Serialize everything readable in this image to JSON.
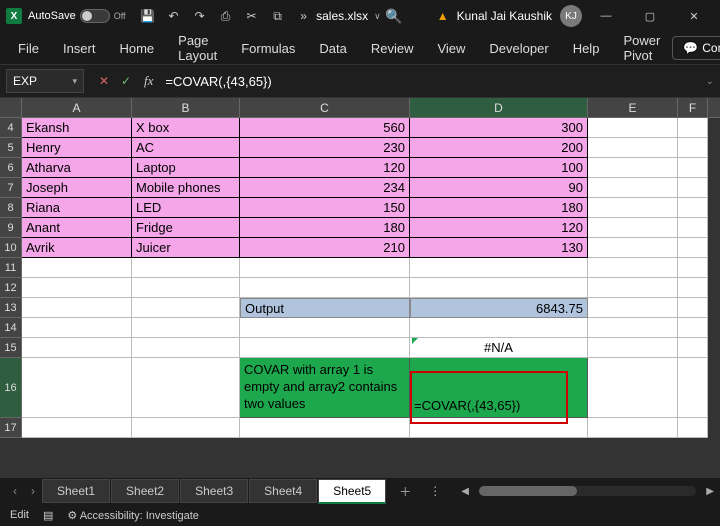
{
  "titlebar": {
    "autosave_label": "AutoSave",
    "autosave_state": "Off",
    "filename": "sales.xlsx",
    "filename_chev": "∨",
    "user_name": "Kunal Jai Kaushik",
    "user_initials": "KJ"
  },
  "ribbon": {
    "tabs": [
      "File",
      "Insert",
      "Home",
      "Page Layout",
      "Formulas",
      "Data",
      "Review",
      "View",
      "Developer",
      "Help",
      "Power Pivot"
    ],
    "comments": "Comments"
  },
  "formula_bar": {
    "namebox": "EXP",
    "formula": "=COVAR(,{43,65})"
  },
  "columns": [
    "A",
    "B",
    "C",
    "D",
    "E",
    "F"
  ],
  "rows": [
    {
      "n": "4",
      "A": "Ekansh",
      "B": "X box",
      "C": "560",
      "D": "300"
    },
    {
      "n": "5",
      "A": "Henry",
      "B": "AC",
      "C": "230",
      "D": "200"
    },
    {
      "n": "6",
      "A": "Atharva",
      "B": "Laptop",
      "C": "120",
      "D": "100"
    },
    {
      "n": "7",
      "A": "Joseph",
      "B": "Mobile phones",
      "C": "234",
      "D": "90"
    },
    {
      "n": "8",
      "A": "Riana",
      "B": "LED",
      "C": "150",
      "D": "180"
    },
    {
      "n": "9",
      "A": "Anant",
      "B": "Fridge",
      "C": "180",
      "D": "120"
    },
    {
      "n": "10",
      "A": "Avrik",
      "B": "Juicer",
      "C": "210",
      "D": "130"
    }
  ],
  "output_row": {
    "n": "13",
    "label": "Output",
    "value": "6843.75"
  },
  "na_row": {
    "n": "15",
    "value": "#N/A"
  },
  "covar_row": {
    "n": "16",
    "desc": "COVAR with array 1 is empty and array2 contains two values",
    "formula": "=COVAR(,{43,65})"
  },
  "empty_rows": [
    "11",
    "12",
    "14",
    "17"
  ],
  "sheets": [
    "Sheet1",
    "Sheet2",
    "Sheet3",
    "Sheet4",
    "Sheet5"
  ],
  "active_sheet": "Sheet5",
  "status": {
    "mode": "Edit",
    "accessibility": "Accessibility: Investigate"
  }
}
